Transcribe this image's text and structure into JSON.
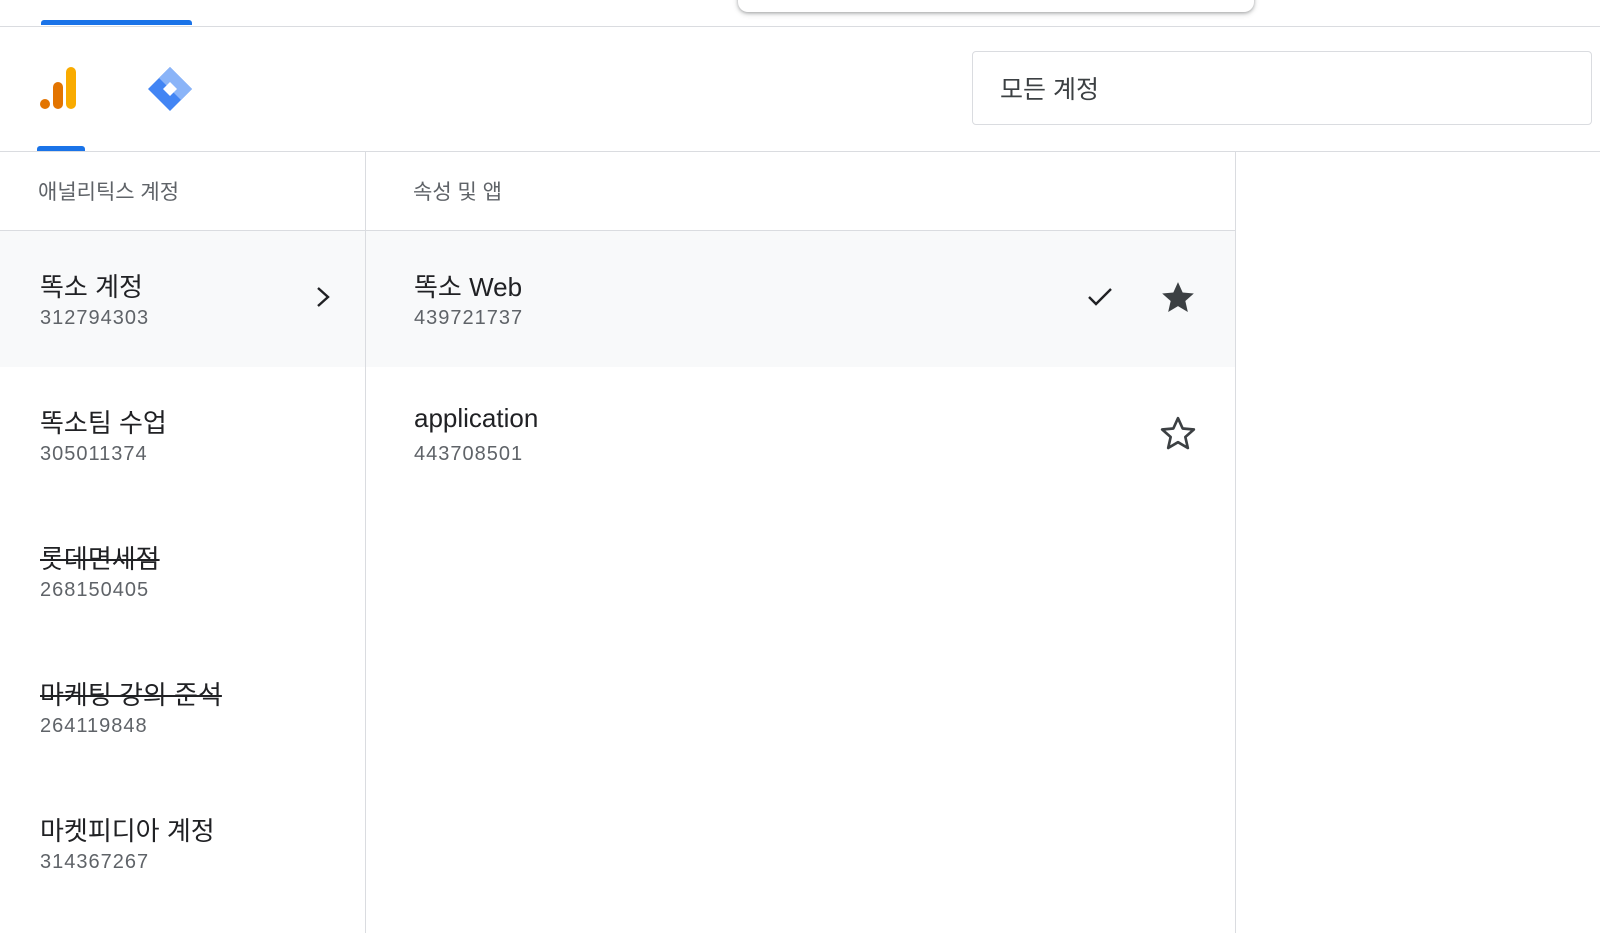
{
  "header": {
    "search_value": "모든 계정"
  },
  "product_tabs": [
    {
      "icon": "analytics-icon",
      "active": true
    },
    {
      "icon": "tag-manager-icon",
      "active": false
    }
  ],
  "colors": {
    "accent": "#1a73e8",
    "analytics_orange": "#e37400",
    "analytics_yellow": "#f9ab00",
    "tagmanager_blue": "#4285f4",
    "tagmanager_light": "#8ab4f8"
  },
  "accounts": {
    "header": "애널리틱스 계정",
    "items": [
      {
        "name": "똑소 계정",
        "id": "312794303"
      },
      {
        "name": "똑소팀 수업",
        "id": "305011374"
      },
      {
        "name": "롯데면세점",
        "id": "268150405"
      },
      {
        "name": "마케팅 강의 준석",
        "id": "264119848"
      },
      {
        "name": "마켓피디아 계정",
        "id": "314367267"
      }
    ]
  },
  "properties": {
    "header": "속성 및 앱",
    "items": [
      {
        "name": "똑소 Web",
        "id": "439721737",
        "starred": true,
        "checked": true
      },
      {
        "name": "application",
        "id": "443708501",
        "starred": false,
        "checked": false
      }
    ]
  }
}
